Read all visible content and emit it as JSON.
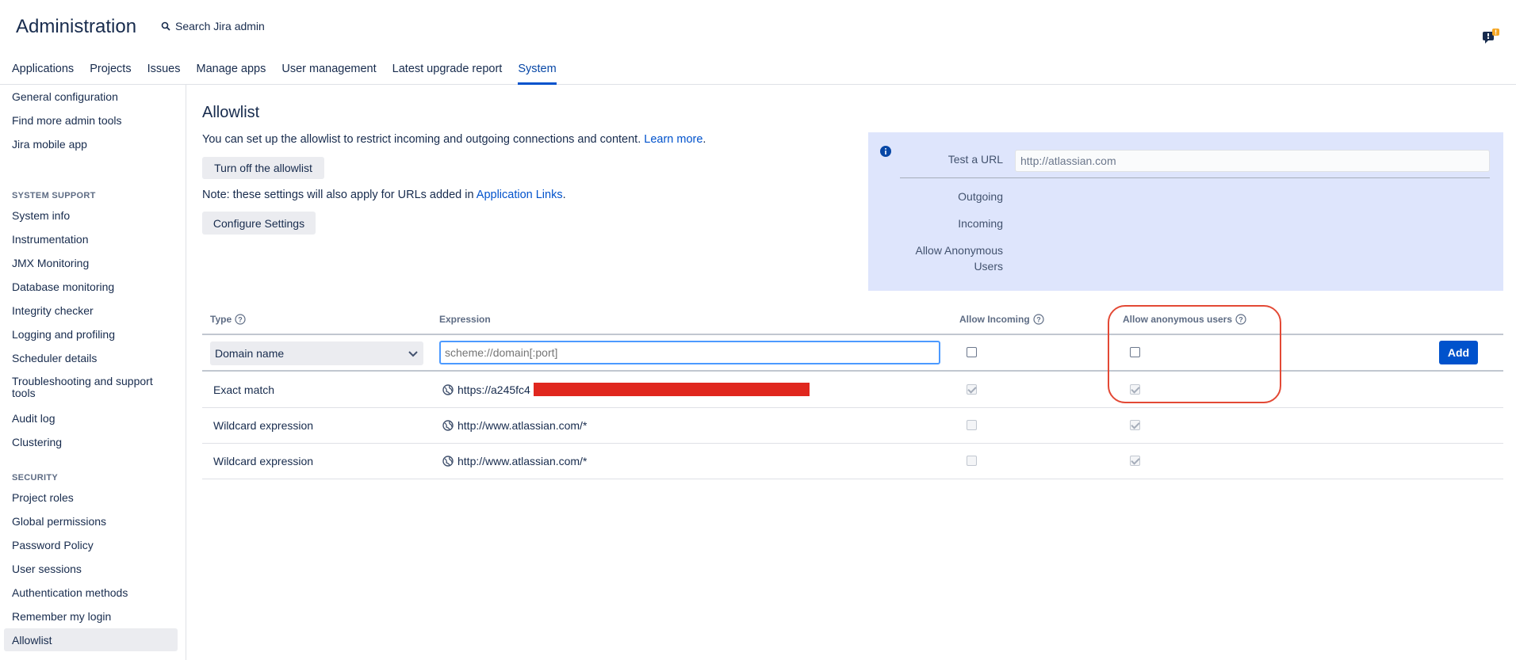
{
  "header": {
    "title": "Administration",
    "search_label": "Search Jira admin",
    "tabs": [
      "Applications",
      "Projects",
      "Issues",
      "Manage apps",
      "User management",
      "Latest upgrade report",
      "System"
    ],
    "active_tab": "System"
  },
  "sidebar": {
    "items_top": [
      "General configuration",
      "Find more admin tools",
      "Jira mobile app"
    ],
    "system_support_heading": "SYSTEM SUPPORT",
    "system_support_items": [
      "System info",
      "Instrumentation",
      "JMX Monitoring",
      "Database monitoring",
      "Integrity checker",
      "Logging and profiling",
      "Scheduler details",
      "Troubleshooting and support tools",
      "Audit log",
      "Clustering"
    ],
    "security_heading": "SECURITY",
    "security_items": [
      "Project roles",
      "Global permissions",
      "Password Policy",
      "User sessions",
      "Authentication methods",
      "Remember my login",
      "Allowlist"
    ],
    "active_item": "Allowlist"
  },
  "main": {
    "title": "Allowlist",
    "intro_text": "You can set up the allowlist to restrict incoming and outgoing connections and content.",
    "learn_more": "Learn more",
    "turn_off_button": "Turn off the allowlist",
    "note_text": "Note: these settings will also apply for URLs added in",
    "app_links": "Application Links",
    "configure_button": "Configure Settings"
  },
  "test_panel": {
    "test_url_label": "Test a URL",
    "test_url_value": "http://atlassian.com",
    "outgoing_label": "Outgoing",
    "incoming_label": "Incoming",
    "anon_label_line1": "Allow Anonymous",
    "anon_label_line2": "Users"
  },
  "table": {
    "headers": {
      "type": "Type",
      "expression": "Expression",
      "allow_incoming": "Allow Incoming",
      "allow_anonymous": "Allow anonymous users"
    },
    "new_row": {
      "type_selected": "Domain name",
      "expression_placeholder": "scheme://domain[:port]",
      "add_button": "Add"
    },
    "rows": [
      {
        "type": "Exact match",
        "expression": "https://a245fc4",
        "incoming": true,
        "anonymous": true
      },
      {
        "type": "Wildcard expression",
        "expression": "http://www.atlassian.com/*",
        "incoming": false,
        "anonymous": true
      },
      {
        "type": "Wildcard expression",
        "expression": "http://www.atlassian.com/*",
        "incoming": false,
        "anonymous": true
      }
    ]
  },
  "colors": {
    "brand": "#0052cc",
    "panel_bg": "#dee5fc",
    "highlight": "#e34935",
    "redaction": "#e0271e"
  }
}
